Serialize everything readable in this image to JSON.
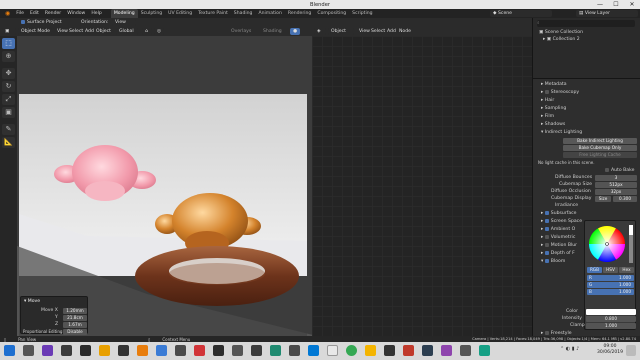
{
  "titlebar": {
    "title": "Blender",
    "minimize": "—",
    "maximize": "☐",
    "close": "✕"
  },
  "menu": {
    "items": [
      "File",
      "Edit",
      "Render",
      "Window",
      "Help"
    ]
  },
  "workspaces": {
    "tabs": [
      "Modeling",
      "Sculpting",
      "UV Editing",
      "Texture Paint",
      "Shading",
      "Animation",
      "Rendering",
      "Compositing",
      "Scripting"
    ],
    "active": "Modeling"
  },
  "scene": {
    "label": "Scene",
    "view_layer": "View Layer"
  },
  "viewport": {
    "surface_project": "Surface Project",
    "orientation_label": "Orientation:",
    "orientation_value": "View",
    "mode": "Object Mode",
    "menus": [
      "View",
      "Select",
      "Add",
      "Object"
    ],
    "transform": "Global",
    "overlays": "Overlays",
    "shading": "Shading"
  },
  "node_editor": {
    "type": "Object",
    "menus": [
      "View",
      "Select",
      "Add",
      "Node"
    ]
  },
  "outliner": {
    "title": "Scene Collection",
    "collection": "Collection 2"
  },
  "props": {
    "sections": [
      {
        "label": "Metadata",
        "open": false
      },
      {
        "label": "Stereoscopy",
        "open": false
      },
      {
        "label": "Hair",
        "open": false
      },
      {
        "label": "Sampling",
        "open": false
      },
      {
        "label": "Film",
        "open": false
      },
      {
        "label": "Shadows",
        "open": false
      },
      {
        "label": "Indirect Lighting",
        "open": true
      }
    ],
    "bake_indirect": "Bake Indirect Lighting",
    "bake_cubemap": "Bake Cubemap Only",
    "free_cache": "Free Lighting Cache",
    "no_cache": "No light cache in this scene.",
    "auto_bake": "Auto Bake",
    "diffuse_bounces_label": "Diffuse Bounces",
    "diffuse_bounces": "3",
    "cubemap_size_label": "Cubemap Size",
    "cubemap_size": "512px",
    "diffuse_occlusion_label": "Diffuse Occlusion",
    "diffuse_occlusion": "32px",
    "cubemap_display_label": "Cubemap Display",
    "cubemap_display_mode": "Size",
    "cubemap_display": "0.300",
    "irradiance_label": "Irradiance",
    "effect_items": [
      "Subsurface",
      "Screen Space",
      "Ambient O",
      "Volumetric",
      "Motion Blur",
      "Depth of F",
      "Bloom"
    ],
    "freestyle": "Freestyle"
  },
  "color_picker": {
    "tabs": [
      "RGB",
      "HSV",
      "Hex"
    ],
    "active_tab": "RGB",
    "r_label": "R",
    "r": "1.000",
    "g_label": "G",
    "g": "1.000",
    "b_label": "B",
    "b": "1.000",
    "color_label": "Color",
    "intensity_label": "Intensity",
    "intensity": "0.800",
    "clamp_label": "Clamp",
    "clamp": "1.000"
  },
  "last_op": {
    "title": "Move",
    "x_label": "Move X",
    "x": "1.20mm",
    "y_label": "Y",
    "y": "21.8cm",
    "z_label": "Z",
    "z": "1.67m",
    "edit_label": "Proportional Editing",
    "edit_value": "Disable"
  },
  "status": {
    "left": "Pan View",
    "middle": "Context Menu",
    "right": "Camera | Verts:18,214 | Faces:18,049 | Tris:36,098 | Objects:1/4 | Mem: 64.1 MB | v2.80.74"
  },
  "taskbar": {
    "time": "09:00",
    "date": "30/06/2019"
  },
  "colors": {
    "accent": "#4772b3",
    "monkey_pink": "#f2a3b0",
    "monkey_gold": "#c8731e",
    "torus": "#7a3d22"
  }
}
